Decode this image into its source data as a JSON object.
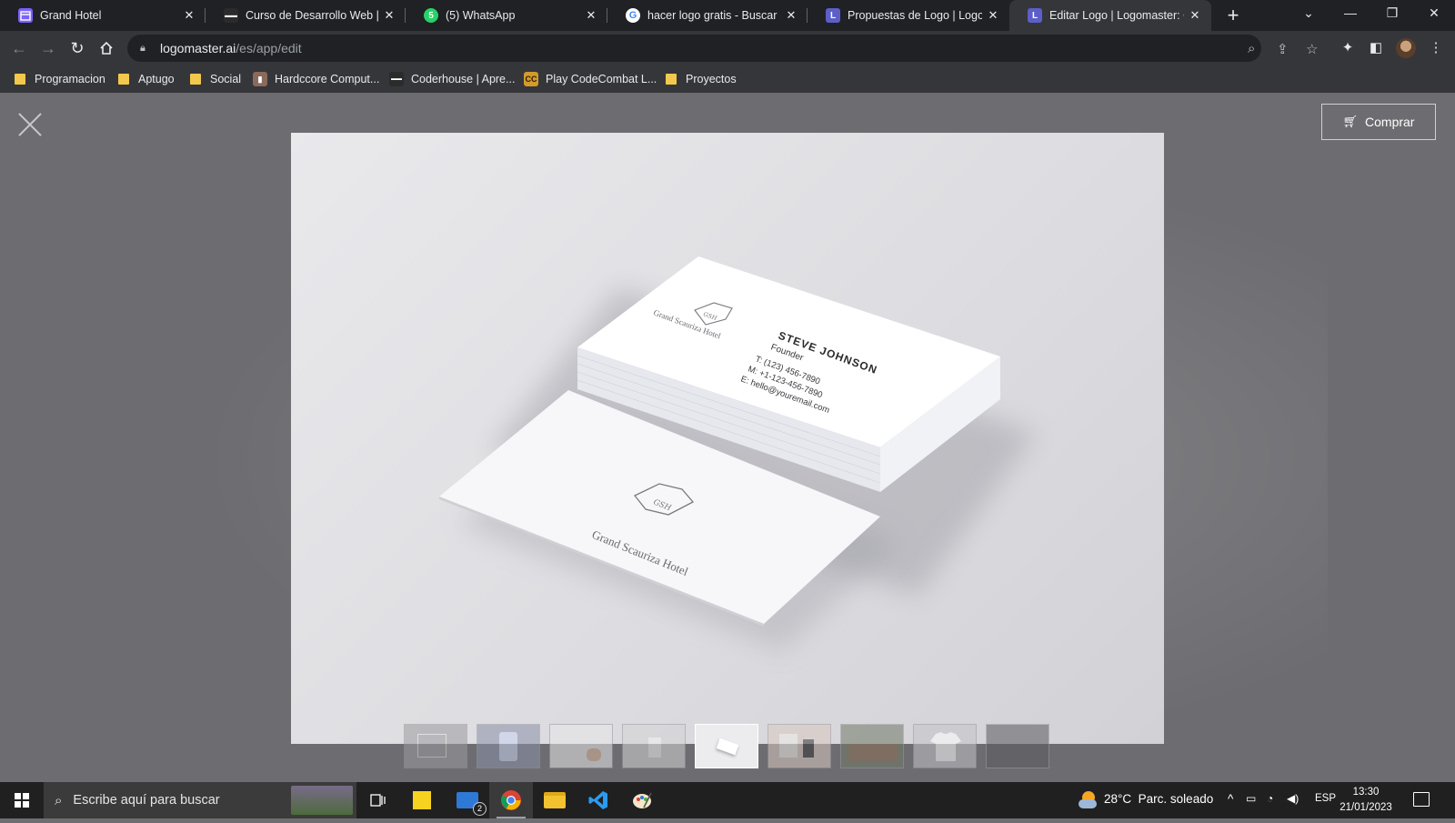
{
  "browser": {
    "tabs": [
      {
        "title": "Grand Hotel",
        "favicon": "calendar-favicon",
        "color": "#7b61ff"
      },
      {
        "title": "Curso de Desarrollo Web | Pla",
        "favicon": "coderhouse-favicon",
        "color": "#ffffff"
      },
      {
        "title": "(5) WhatsApp",
        "favicon": "whatsapp-favicon",
        "badge": "5",
        "color": "#25d366"
      },
      {
        "title": "hacer logo gratis - Buscar con",
        "favicon": "google-favicon",
        "color": "#ffffff"
      },
      {
        "title": "Propuestas de Logo | Logoma",
        "favicon": "logomaster-favicon",
        "favicon_letter": "L",
        "color": "#5b5fc7"
      },
      {
        "title": "Editar Logo | Logomaster: On",
        "favicon": "logomaster-favicon",
        "favicon_letter": "L",
        "color": "#5b5fc7",
        "active": true
      }
    ],
    "url_host": "logomaster.ai",
    "url_path": "/es/app/edit",
    "bookmarks": [
      {
        "label": "Programacion",
        "type": "folder"
      },
      {
        "label": "Aptugo",
        "type": "folder"
      },
      {
        "label": "Social",
        "type": "folder"
      },
      {
        "label": "Hardccore Comput...",
        "type": "site"
      },
      {
        "label": "Coderhouse | Apre...",
        "type": "site"
      },
      {
        "label": "Play CodeCombat L...",
        "type": "site",
        "favicon_letter": "CC"
      },
      {
        "label": "Proyectos",
        "type": "folder"
      }
    ]
  },
  "page": {
    "buy_label": "Comprar",
    "mockup": {
      "brand_name": "Grand Scauriza Hotel",
      "monogram": "GSH",
      "person_name": "STEVE JOHNSON",
      "person_role": "Founder",
      "phone_t": "T: (123) 456-7890",
      "phone_m": "M: +1-123-456-7890",
      "email": "E: hello@youremail.com"
    },
    "thumbnails": [
      {
        "name": "facade",
        "bg": "#9c9ca0"
      },
      {
        "name": "phone-in-hand",
        "bg": "#8a90a6"
      },
      {
        "name": "hand-card",
        "bg": "#e7e7ea"
      },
      {
        "name": "bag",
        "bg": "#d4d4d6"
      },
      {
        "name": "business-cards",
        "bg": "#ececef",
        "active": true
      },
      {
        "name": "stationery",
        "bg": "#d9c9c0"
      },
      {
        "name": "storefront",
        "bg": "#6f7a66"
      },
      {
        "name": "t-shirt",
        "bg": "#c4c4c8"
      },
      {
        "name": "dark-wall",
        "bg": "#5b5b5f"
      }
    ]
  },
  "taskbar": {
    "search_placeholder": "Escribe aquí para buscar",
    "mail_badge": "2",
    "weather": "28°C  Parc. soleado",
    "lang": "ESP",
    "time": "13:30",
    "date": "21/01/2023"
  }
}
